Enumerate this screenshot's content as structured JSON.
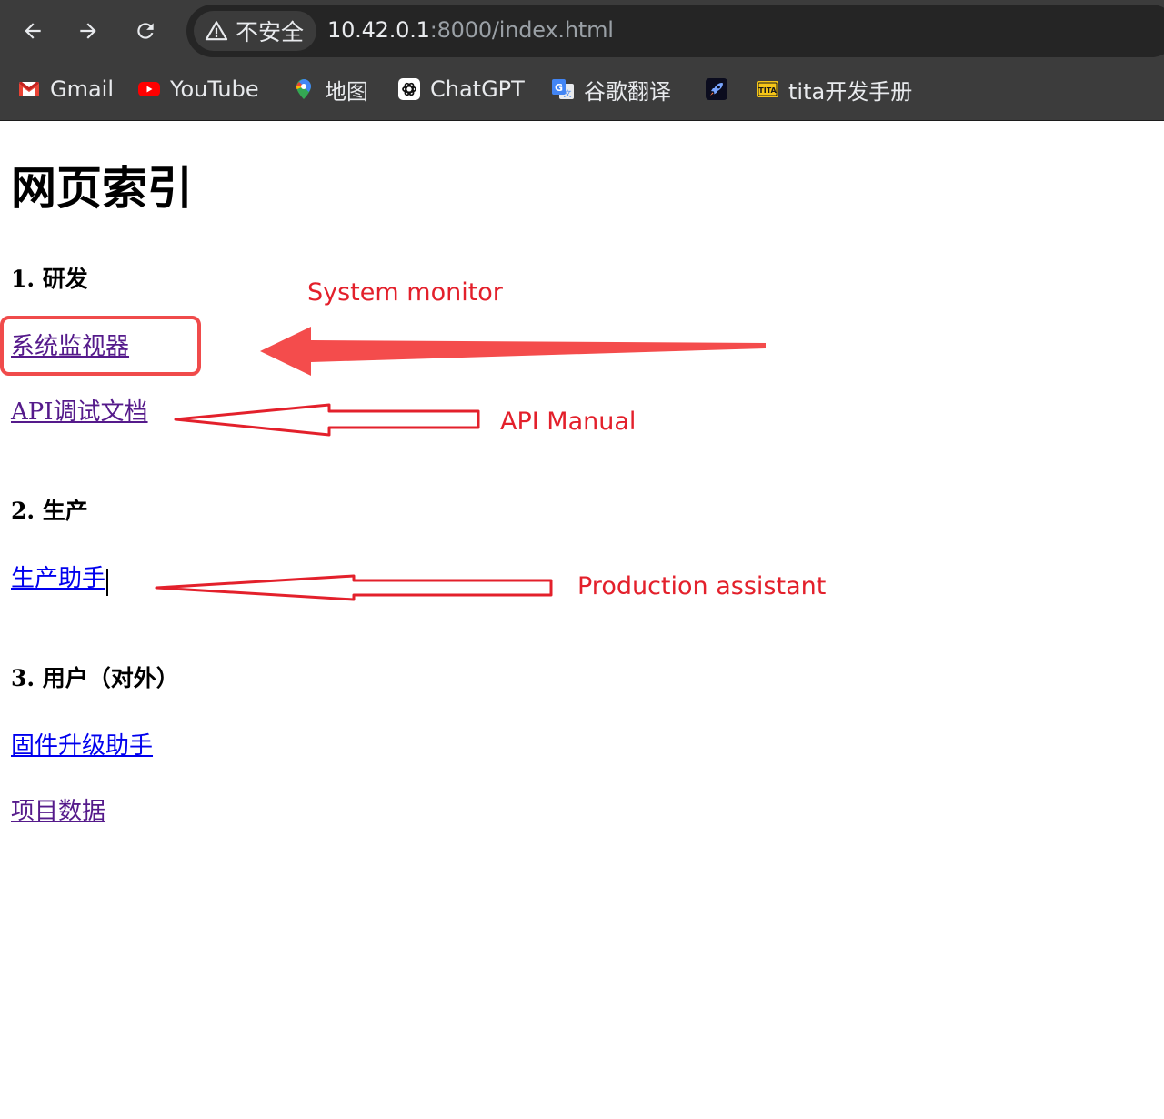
{
  "browser": {
    "nav": {
      "back_icon": "arrow-left-icon",
      "forward_icon": "arrow-right-icon",
      "reload_icon": "reload-icon"
    },
    "security_chip": {
      "icon": "warning-triangle-icon",
      "label": "不安全"
    },
    "url": {
      "host": "10.42.0.1",
      "rest": ":8000/index.html"
    },
    "bookmarks": [
      {
        "label": "Gmail",
        "icon": "gmail-icon"
      },
      {
        "label": "YouTube",
        "icon": "youtube-icon"
      },
      {
        "label": "地图",
        "icon": "google-maps-icon"
      },
      {
        "label": "ChatGPT",
        "icon": "chatgpt-icon"
      },
      {
        "label": "谷歌翻译",
        "icon": "google-translate-icon"
      },
      {
        "label": "",
        "icon": "rocket-icon"
      },
      {
        "label": "tita开发手册",
        "icon": "tita-icon"
      }
    ]
  },
  "page": {
    "title": "网页索引",
    "sections": [
      {
        "heading": "1. 研发",
        "links": [
          {
            "label": "系统监视器",
            "visited": true
          },
          {
            "label": "API调试文档",
            "visited": true
          }
        ]
      },
      {
        "heading": "2. 生产",
        "links": [
          {
            "label": "生产助手",
            "visited": false
          }
        ]
      },
      {
        "heading": "3. 用户（对外）",
        "links": [
          {
            "label": "固件升级助手",
            "visited": false
          },
          {
            "label": "项目数据",
            "visited": true
          }
        ]
      }
    ]
  },
  "annotations": {
    "color": "#e3202b",
    "labels": [
      {
        "text": "System monitor",
        "target": "系统监视器"
      },
      {
        "text": "API Manual",
        "target": "API调试文档"
      },
      {
        "text": "Production assistant",
        "target": "生产助手"
      }
    ]
  }
}
